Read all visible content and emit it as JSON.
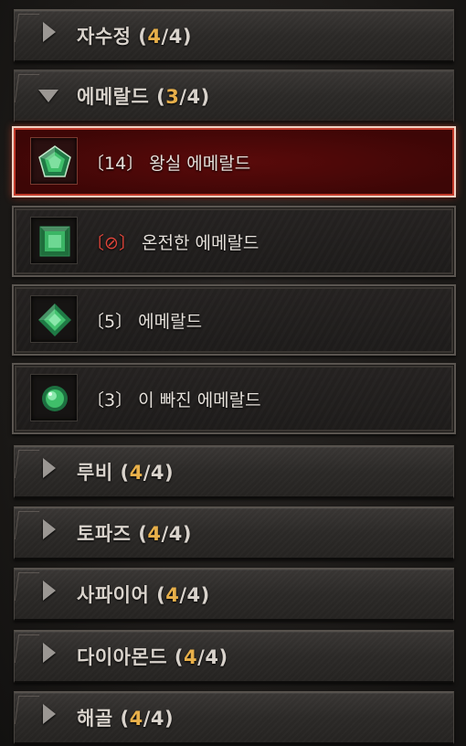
{
  "categories": [
    {
      "name": "자수정",
      "count": "4",
      "total": "4",
      "open": false
    },
    {
      "name": "에메랄드",
      "count": "3",
      "total": "4",
      "open": true
    },
    {
      "name": "루비",
      "count": "4",
      "total": "4",
      "open": false
    },
    {
      "name": "토파즈",
      "count": "4",
      "total": "4",
      "open": false
    },
    {
      "name": "사파이어",
      "count": "4",
      "total": "4",
      "open": false
    },
    {
      "name": "다이아몬드",
      "count": "4",
      "total": "4",
      "open": false
    },
    {
      "name": "해골",
      "count": "4",
      "total": "4",
      "open": false
    }
  ],
  "emerald_items": [
    {
      "level": "14",
      "name": "왕실 에메랄드",
      "selected": true,
      "icon": "emerald-royal-icon"
    },
    {
      "level": "⊘",
      "name": "온전한 에메랄드",
      "selected": false,
      "icon": "emerald-flawless-icon",
      "level_color": "#e0453a"
    },
    {
      "level": "5",
      "name": "에메랄드",
      "selected": false,
      "icon": "emerald-icon"
    },
    {
      "level": "3",
      "name": "이 빠진 에메랄드",
      "selected": false,
      "icon": "emerald-chipped-icon"
    }
  ],
  "colors": {
    "count_accent": "#e8b04a",
    "selected_bg": "#4a0808",
    "gem_green": "#3fbf6a"
  }
}
